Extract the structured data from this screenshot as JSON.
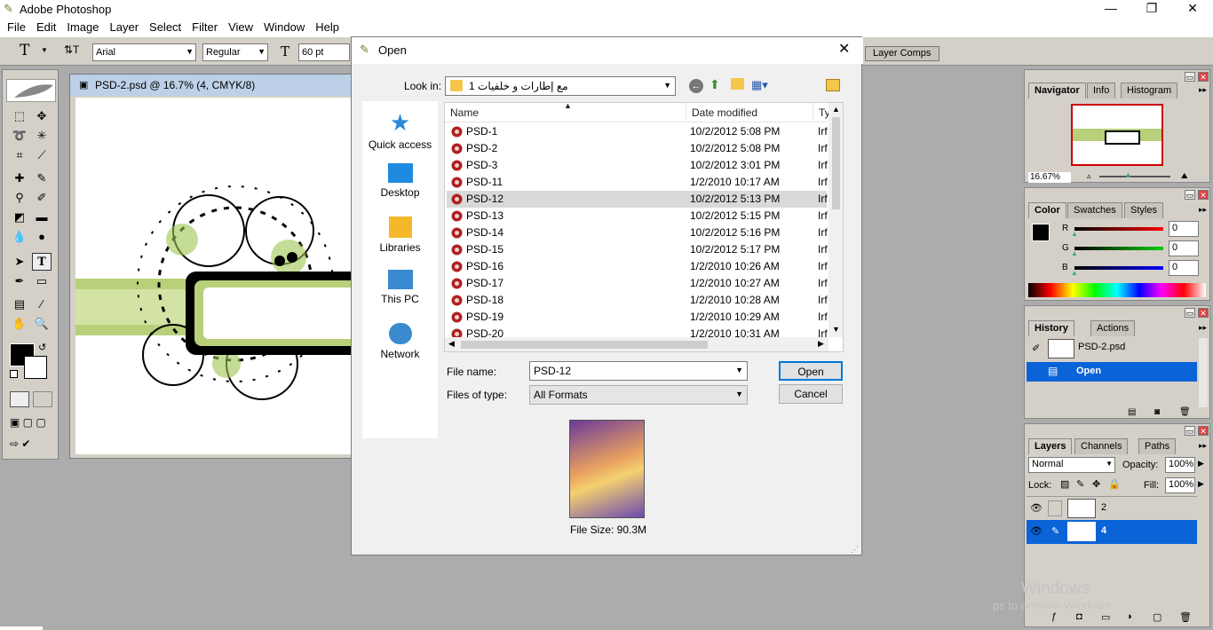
{
  "app": {
    "title": "Adobe Photoshop"
  },
  "menus": [
    "File",
    "Edit",
    "Image",
    "Layer",
    "Select",
    "Filter",
    "View",
    "Window",
    "Help"
  ],
  "options": {
    "font_family": "Arial",
    "font_style": "Regular",
    "font_size": "60 pt",
    "layer_comps_tab": "Layer Comps"
  },
  "document": {
    "title": "PSD-2.psd @ 16.7% (4, CMYK/8)"
  },
  "dialog": {
    "title": "Open",
    "look_in_label": "Look in:",
    "look_in_value": "مع إطارات و خلفيات 1",
    "places": [
      "Quick access",
      "Desktop",
      "Libraries",
      "This PC",
      "Network"
    ],
    "columns": {
      "name": "Name",
      "date": "Date modified",
      "type": "Ty"
    },
    "files": [
      {
        "name": "PSD-1",
        "date": "10/2/2012 5:08 PM",
        "type": "Irf"
      },
      {
        "name": "PSD-2",
        "date": "10/2/2012 5:08 PM",
        "type": "Irf"
      },
      {
        "name": "PSD-3",
        "date": "10/2/2012 3:01 PM",
        "type": "Irf"
      },
      {
        "name": "PSD-11",
        "date": "1/2/2010 10:17 AM",
        "type": "Irf"
      },
      {
        "name": "PSD-12",
        "date": "10/2/2012 5:13 PM",
        "type": "Irf",
        "selected": true
      },
      {
        "name": "PSD-13",
        "date": "10/2/2012 5:15 PM",
        "type": "Irf"
      },
      {
        "name": "PSD-14",
        "date": "10/2/2012 5:16 PM",
        "type": "Irf"
      },
      {
        "name": "PSD-15",
        "date": "10/2/2012 5:17 PM",
        "type": "Irf"
      },
      {
        "name": "PSD-16",
        "date": "1/2/2010 10:26 AM",
        "type": "Irf"
      },
      {
        "name": "PSD-17",
        "date": "1/2/2010 10:27 AM",
        "type": "Irf"
      },
      {
        "name": "PSD-18",
        "date": "1/2/2010 10:28 AM",
        "type": "Irf"
      },
      {
        "name": "PSD-19",
        "date": "1/2/2010 10:29 AM",
        "type": "Irf"
      },
      {
        "name": "PSD-20",
        "date": "1/2/2010 10:31 AM",
        "type": "Irf"
      }
    ],
    "file_name_label": "File name:",
    "file_name_value": "PSD-12",
    "file_type_label": "Files of type:",
    "file_type_value": "All Formats",
    "open_button": "Open",
    "cancel_button": "Cancel",
    "file_size": "File Size: 90.3M"
  },
  "navigator": {
    "tabs": [
      "Navigator",
      "Info",
      "Histogram"
    ],
    "zoom": "16.67%"
  },
  "color": {
    "tabs": [
      "Color",
      "Swatches",
      "Styles"
    ],
    "channels": [
      {
        "label": "R",
        "value": "0"
      },
      {
        "label": "G",
        "value": "0"
      },
      {
        "label": "B",
        "value": "0"
      }
    ]
  },
  "history": {
    "tabs": [
      "History",
      "Actions"
    ],
    "items": [
      "PSD-2.psd",
      "Open"
    ]
  },
  "layers": {
    "tabs": [
      "Layers",
      "Channels",
      "Paths"
    ],
    "blend_mode": "Normal",
    "opacity_label": "Opacity:",
    "opacity": "100%",
    "lock_label": "Lock:",
    "fill_label": "Fill:",
    "fill": "100%",
    "items": [
      "2",
      "4"
    ]
  },
  "watermark": {
    "line1": "Windows",
    "line2": "ps to activate Windows."
  }
}
